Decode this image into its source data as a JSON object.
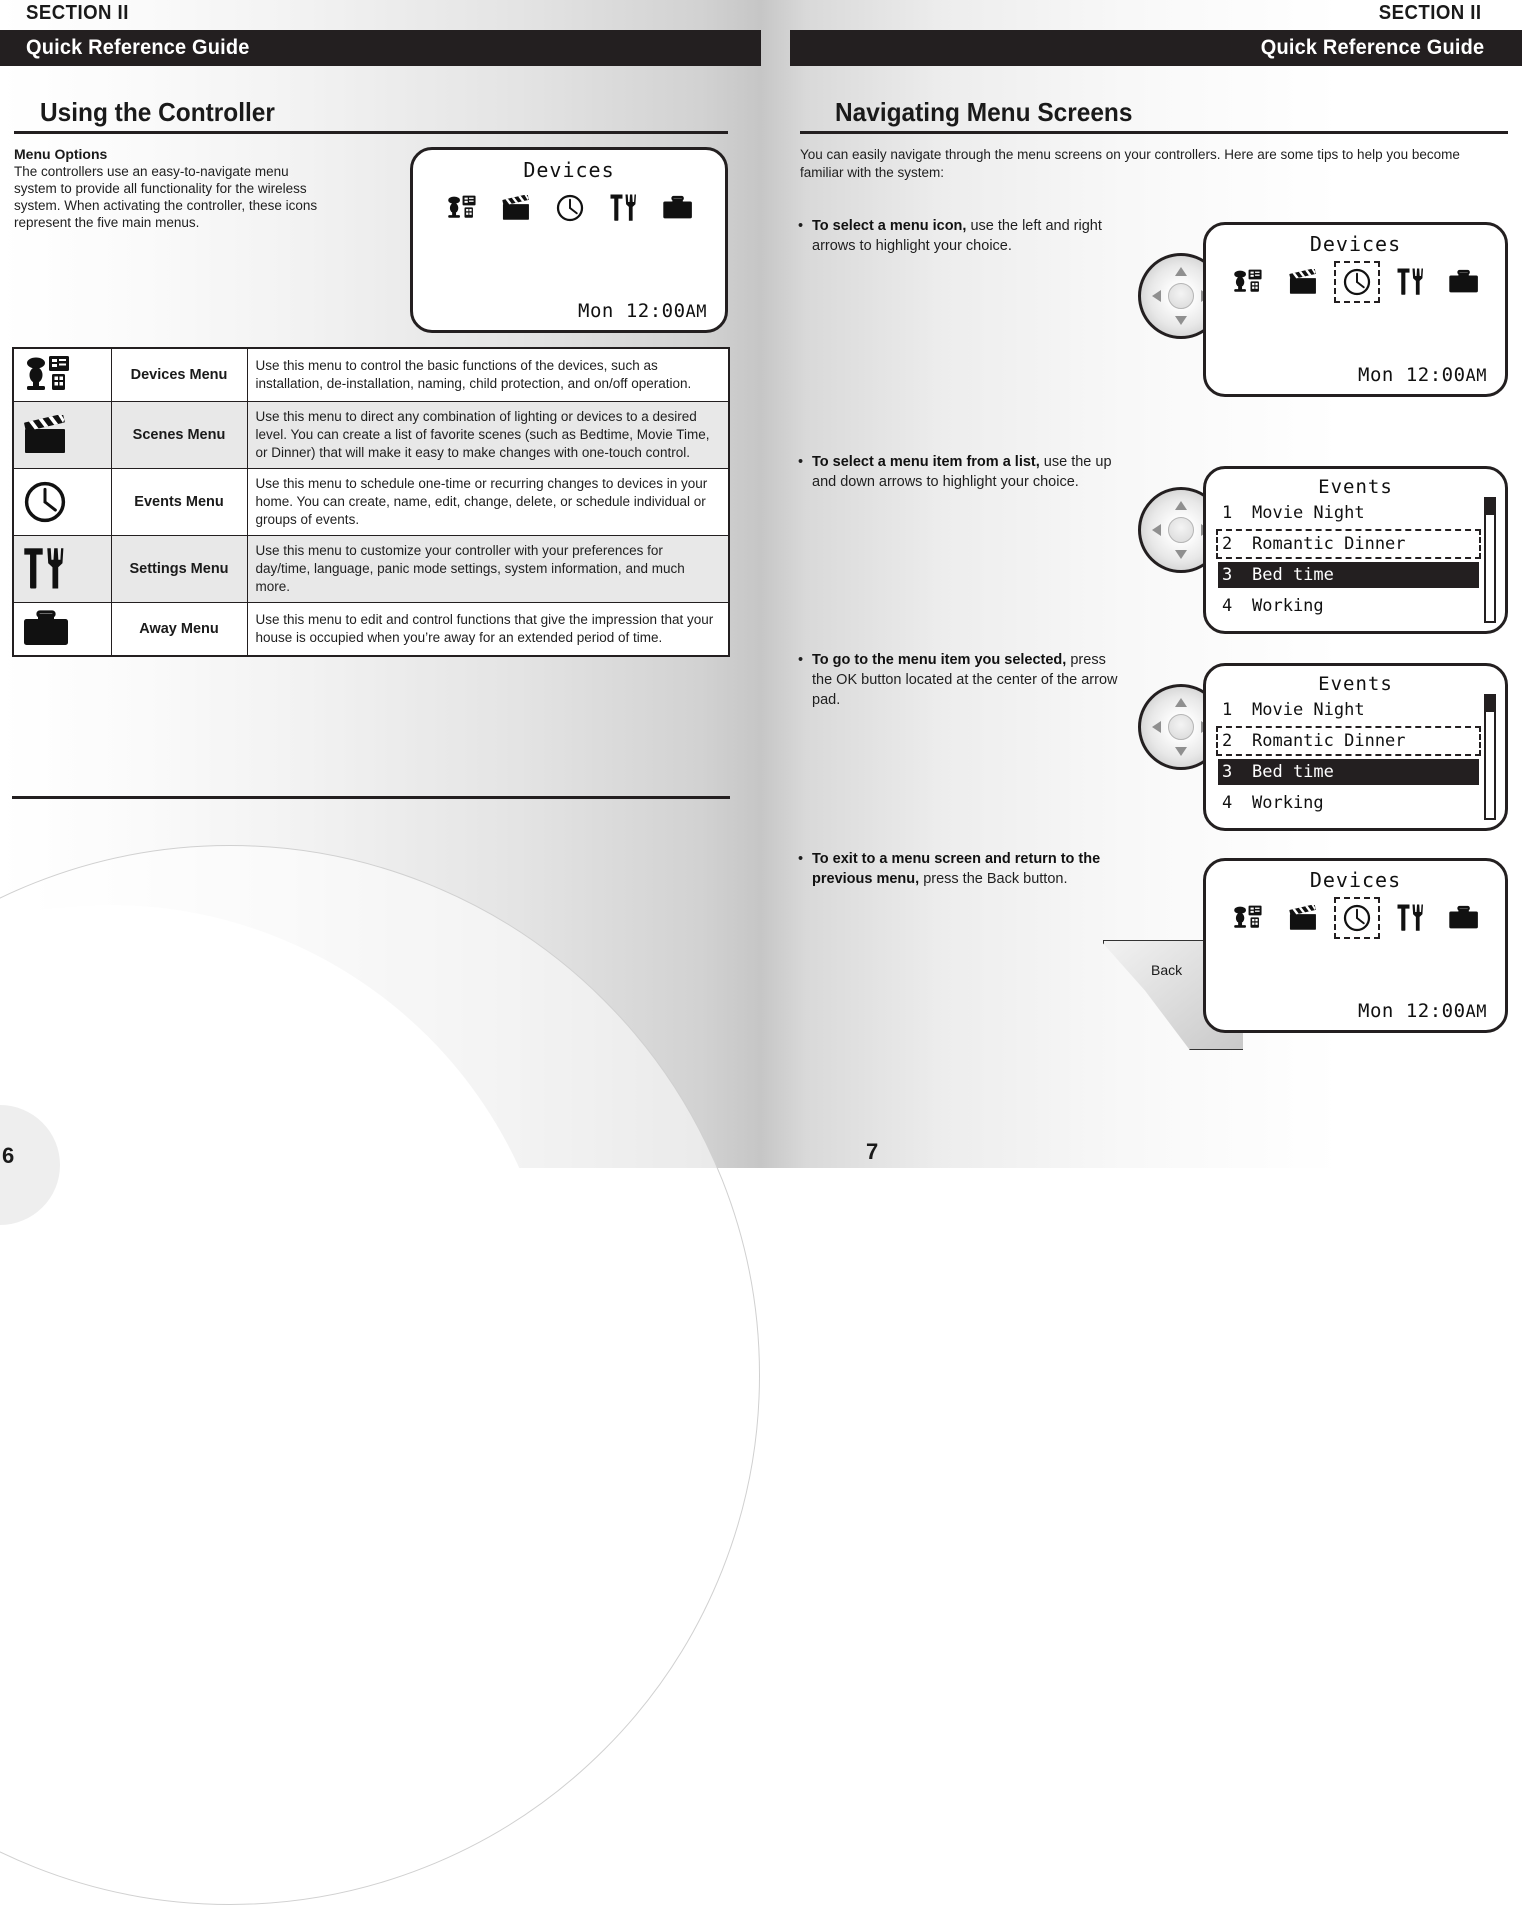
{
  "left_page": {
    "section_kicker": "SECTION II",
    "bar_title": "Quick Reference Guide",
    "heading": "Using the Controller",
    "menu_options": {
      "title": "Menu Options",
      "body": "The controllers use an easy-to-navigate menu system to provide all functionality for the wireless system. When activating the controller, these icons represent the five main menus."
    },
    "screen": {
      "title": "Devices",
      "clock_day": "Mon",
      "clock_time": "12:00",
      "clock_ampm": "AM",
      "icons": [
        "devices-icon",
        "scenes-icon",
        "events-icon",
        "settings-icon",
        "away-icon"
      ]
    },
    "table": {
      "rows": [
        {
          "icon": "devices-icon",
          "name": "Devices Menu",
          "description": "Use this menu to control the basic functions of the devices, such as installation, de-installation, naming, child protection, and on/off operation."
        },
        {
          "icon": "scenes-icon",
          "name": "Scenes Menu",
          "description": "Use this menu to direct any combination of lighting or devices to a desired level. You can create a list of favorite scenes (such as Bedtime, Movie Time, or Dinner) that will make it easy to make changes with one-touch control."
        },
        {
          "icon": "events-icon",
          "name": "Events Menu",
          "description": "Use this menu to schedule one-time or recurring changes to devices in your home. You can create, name, edit, change, delete, or schedule individual or groups of events."
        },
        {
          "icon": "settings-icon",
          "name": "Settings Menu",
          "description": "Use this menu to customize your controller with your preferences for day/time, language, panic mode settings, system information, and much more."
        },
        {
          "icon": "away-icon",
          "name": "Away Menu",
          "description": "Use this menu to edit and control functions that give the impression that your house is occupied when you’re away for an extended period of time."
        }
      ]
    },
    "page_number": "6"
  },
  "right_page": {
    "section_kicker": "SECTION II",
    "bar_title": "Quick Reference Guide",
    "heading": "Navigating Menu Screens",
    "intro": "You can easily navigate through the menu screens on your controllers. Here are some tips to help you become familiar with the system:",
    "bullets": [
      {
        "bold": "To select a menu icon,",
        "rest": " use the left and right arrows to highlight your choice."
      },
      {
        "bold": "To select a menu item from a list,",
        "rest": " use the up and down arrows to highlight your choice."
      },
      {
        "bold": "To go to the menu item you selected,",
        "rest": " press the OK button located at the center of the arrow pad."
      },
      {
        "bold": "To exit to a menu screen and return to the previous menu,",
        "rest": " press the Back button."
      }
    ],
    "screens": {
      "devices_nav": {
        "title": "Devices",
        "clock_day": "Mon",
        "clock_time": "12:00",
        "clock_ampm": "AM",
        "selected_icon_index": 2
      },
      "events_list_1": {
        "title": "Events",
        "items": [
          {
            "num": "1",
            "label": "Movie Night",
            "state": "normal"
          },
          {
            "num": "2",
            "label": "Romantic Dinner",
            "state": "dashed"
          },
          {
            "num": "3",
            "label": "Bed time",
            "state": "active"
          },
          {
            "num": "4",
            "label": "Working",
            "state": "normal"
          }
        ]
      },
      "events_list_2": {
        "title": "Events",
        "items": [
          {
            "num": "1",
            "label": "Movie Night",
            "state": "normal"
          },
          {
            "num": "2",
            "label": "Romantic Dinner",
            "state": "dashed"
          },
          {
            "num": "3",
            "label": "Bed time",
            "state": "active"
          },
          {
            "num": "4",
            "label": "Working",
            "state": "normal"
          }
        ]
      },
      "devices_back": {
        "title": "Devices",
        "clock_day": "Mon",
        "clock_time": "12:00",
        "clock_ampm": "AM",
        "selected_icon_index": 2
      }
    },
    "back_callout_label": "Back",
    "page_number": "7"
  },
  "colors": {
    "bar": "#231f20",
    "alt_row": "#e8e8e8",
    "text": "#1f1f1f"
  }
}
